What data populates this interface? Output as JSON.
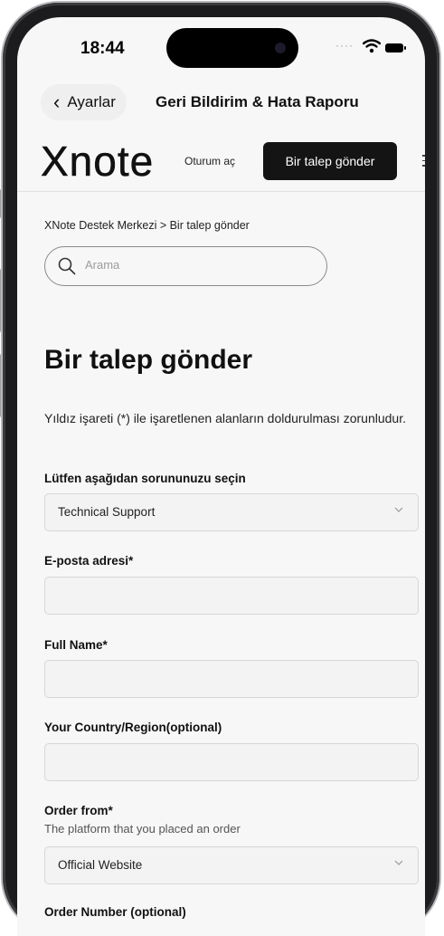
{
  "status_bar": {
    "time": "18:44"
  },
  "nav": {
    "back_label": "Ayarlar",
    "title": "Geri Bildirim & Hata Raporu"
  },
  "site_header": {
    "logo_text": "Xnote",
    "sign_in": "Oturum aç",
    "submit_button": "Bir talep gönder"
  },
  "breadcrumb": {
    "text": "XNote Destek Merkezi >  Bir talep gönder"
  },
  "search": {
    "placeholder": "Arama"
  },
  "page": {
    "title": "Bir talep gönder",
    "required_note": "Yıldız işareti (*) ile işaretlenen alanların doldurulması zorunludur."
  },
  "form": {
    "issue_label": "Lütfen aşağıdan sorununuzu seçin",
    "issue_value": "Technical Support",
    "email_label": "E-posta adresi*",
    "email_value": "",
    "fullname_label": "Full Name*",
    "fullname_value": "",
    "country_label": "Your Country/Region(optional)",
    "country_value": "",
    "order_from_label": "Order from*",
    "order_from_hint": "The platform that you placed an order",
    "order_from_value": "Official Website",
    "order_number_label": "Order Number (optional)"
  }
}
